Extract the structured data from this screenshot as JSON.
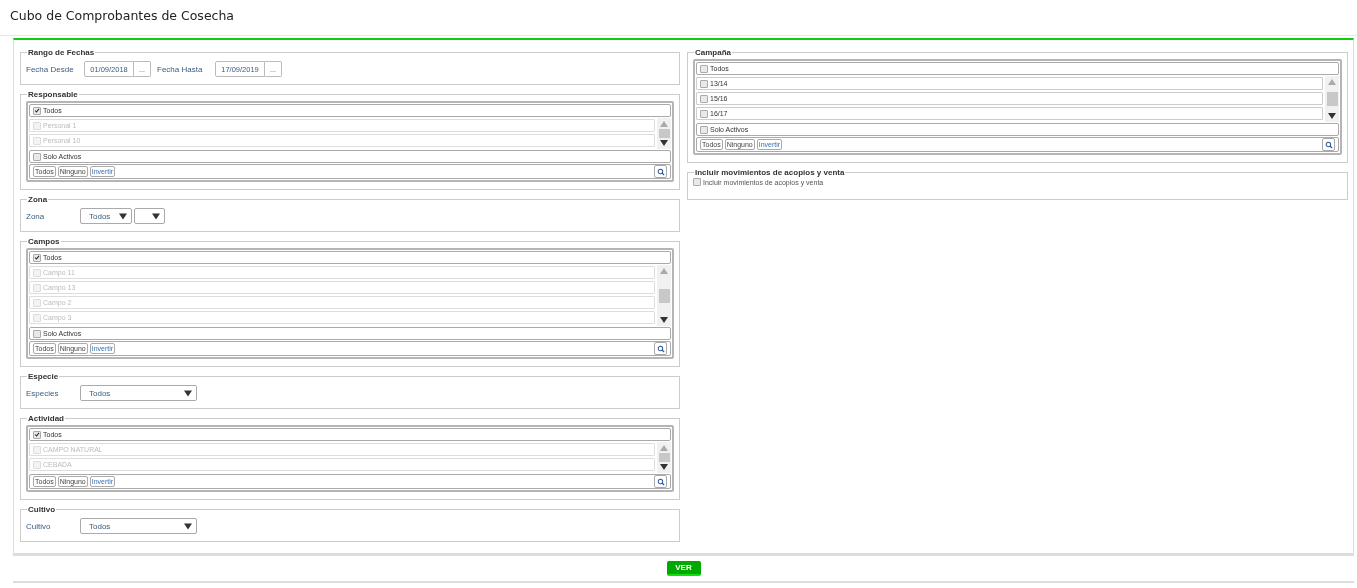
{
  "page": {
    "title": "Cubo de Comprobantes de Cosecha"
  },
  "left": [
    {
      "kind": "dates",
      "legend": "Rango de Fechas",
      "fields": [
        {
          "label": "Fecha Desde",
          "value": "01/09/2018",
          "button": "..."
        },
        {
          "label": "Fecha Hasta",
          "value": "17/09/2019",
          "button": "..."
        }
      ]
    },
    {
      "kind": "multiselect",
      "legend": "Responsable",
      "all": {
        "label": "Todos",
        "checked": true
      },
      "items": [
        {
          "label": "Personal 1",
          "checked": false,
          "disabled": true
        },
        {
          "label": "Personal 10",
          "checked": false,
          "disabled": true
        }
      ],
      "only_active": {
        "label": "Solo Activos",
        "checked": false
      },
      "actions": [
        "Todos",
        "Ninguno",
        "Invertir"
      ]
    },
    {
      "kind": "selects",
      "legend": "Zona",
      "label": "Zona",
      "selects": [
        {
          "kind": "value",
          "value": "Todos"
        },
        {
          "kind": "blank"
        }
      ]
    },
    {
      "kind": "multiselect",
      "legend": "Campos",
      "all": {
        "label": "Todos",
        "checked": true
      },
      "items": [
        {
          "label": "Campo 11",
          "checked": false,
          "disabled": true
        },
        {
          "label": "Campo 13",
          "checked": false,
          "disabled": true
        },
        {
          "label": "Campo 2",
          "checked": false,
          "disabled": true
        },
        {
          "label": "Campo 3",
          "checked": false,
          "disabled": true
        }
      ],
      "only_active": {
        "label": "Solo Activos",
        "checked": false
      },
      "actions": [
        "Todos",
        "Ninguno",
        "Invertir"
      ]
    },
    {
      "kind": "selects",
      "legend": "Especie",
      "label": "Especies",
      "selects": [
        {
          "value": "Todos"
        }
      ]
    },
    {
      "kind": "multiselect",
      "legend": "Actividad",
      "all": {
        "label": "Todos",
        "checked": true
      },
      "items": [
        {
          "label": "CAMPO NATURAL",
          "checked": false,
          "disabled": true
        },
        {
          "label": "CEBADA",
          "checked": false,
          "disabled": true
        }
      ],
      "actions": [
        "Todos",
        "Ninguno",
        "Invertir"
      ]
    },
    {
      "kind": "selects",
      "legend": "Cultivo",
      "label": "Cultivo",
      "selects": [
        {
          "value": "Todos"
        }
      ]
    }
  ],
  "right": [
    {
      "kind": "multiselect",
      "legend": "Campaña",
      "all": {
        "label": "Todos",
        "checked": false
      },
      "items": [
        {
          "label": "13/14",
          "checked": false,
          "disabled": false
        },
        {
          "label": "15/16",
          "checked": false,
          "disabled": false
        },
        {
          "label": "16/17",
          "checked": false,
          "disabled": false
        }
      ],
      "only_active": {
        "label": "Solo Activos",
        "checked": false
      },
      "actions": [
        "Todos",
        "Ninguno",
        "Invertir"
      ]
    },
    {
      "kind": "checkbox",
      "legend": "Incluir movimientos de acopios y venta",
      "label": "Incluir movimientos de acopios y venta",
      "checked": false
    }
  ],
  "footer": {
    "button": "VER"
  }
}
